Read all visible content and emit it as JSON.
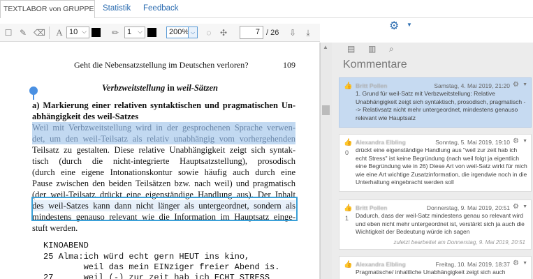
{
  "nav": {
    "brand": "TEXTLABOR von GRUPPE ...",
    "links": [
      "Statistik",
      "Feedback"
    ]
  },
  "toolbar": {
    "font_size": "10",
    "stroke_width": "1",
    "zoom": "200%",
    "page_current": "7",
    "page_total": "/ 26",
    "icons": [
      "square-icon",
      "brush-icon",
      "eraser-icon",
      "font-icon",
      "pencil-icon",
      "hide-icon",
      "shrink-icon",
      "download-page-icon",
      "download-icon"
    ],
    "swatch_color": "#000000"
  },
  "document": {
    "header_title": "Geht die Nebensatzstellung im Deutschen verloren?",
    "page_number": "109",
    "section_title_a": "Verbzweitstellung",
    "section_title_b": " in ",
    "section_title_c": "weil-Sätzen",
    "lines": [
      "a) Markierung einer relativen syntaktischen und pragmatischen Un-",
      "abhängigkeit des weil-Satzes",
      "Weil mit Verbzweitstellung wird in der gesprochenen Sprache verwen-",
      "det, um den weil-Teilsatz als relativ unabhängig vom vorhergehenden",
      "Teilsatz zu gestalten. Diese relative Unabhängigkeit zeigt sich syntak-",
      "tisch (durch die nicht-integrierte Hauptsatzstellung), prosodisch",
      "(durch eine eigene Intonationskontur sowie häufig auch durch eine",
      "Pause zwischen den beiden Teilsätzen bzw. nach weil) und pragmatisch",
      "(der weil-Teilsatz drückt eine eigenständige Handlung aus). Der Inhalt",
      "des weil-Satzes kann dann nicht länger als untergeordnet, sondern als",
      "mindestens genauso relevant wie die Information im Hauptsatz einge-",
      "stuft werden."
    ],
    "transcript": [
      "KINOABEND",
      "25 Alma:ich würd echt gern HEUT ins kino,",
      "        weil das mein EINziger freier Abend is.",
      "27      weil (-) zur zeit hab ich ECHT STRESS"
    ]
  },
  "comments_pane": {
    "title": "Kommentare",
    "tab_icons": [
      "book-icon",
      "document-icon",
      "search-icon"
    ],
    "comments": [
      {
        "author": "Britt Pollen",
        "date": "Samstag, 4. Mai 2019, 21:20",
        "votes": "",
        "text": "1. Grund für weil-Satz mit Verbzweitstellung: Relative Unabhängigkeit zeigt sich syntaktisch, prosodisch, pragmatisch --> Relativsatz nicht mehr untergeordnet, mindestens genauso relevant wie Hauptsatz",
        "edited": ""
      },
      {
        "author": "Alexandra Elbling",
        "date": "Sonntag, 5. Mai 2019, 19:10",
        "votes": "0",
        "text": "drückt eine eigenständige Handlung aus \"weil zur zeit hab ich echt Stress\" ist keine Begründung (nach weil folgt ja eigentlich eine Begründung wie in 26) Diese Art von weil-Satz wirkt für mich wie eine Art wichtige Zusatzinformation, die irgendwie noch in die Unterhaltung eingebracht werden soll",
        "edited": ""
      },
      {
        "author": "Britt Pollen",
        "date": "Donnerstag, 9. Mai 2019, 20:51",
        "votes": "1",
        "text": "Dadurch, dass der weil-Satz mindestens genau so relevant wird und eben nicht mehr untergeordnet ist, verstärkt sich ja auch die Wichtigkeit der Bedeutung würde ich sagen",
        "edited": "zuletzt bearbeitet am Donnerstag, 9. Mai 2019, 20:51"
      },
      {
        "author": "Alexandra Elbling",
        "date": "Freitag, 10. Mai 2019, 18:37",
        "votes": "",
        "text": "Pragmatische/ inhaltliche Unabhängigkeit zeigt sich auch",
        "edited": ""
      }
    ]
  },
  "colors": {
    "accent": "#2b6cb0",
    "highlight": "#78aae1",
    "selection_border": "#3aa0d8",
    "active_comment": "#c6daf1"
  }
}
